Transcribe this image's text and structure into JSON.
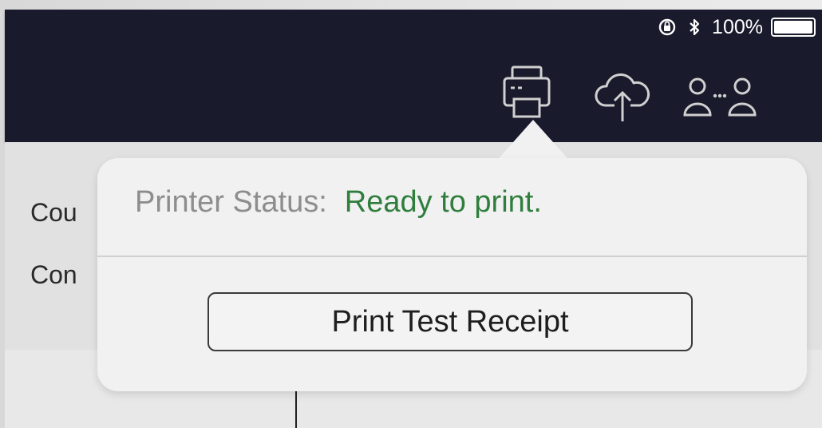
{
  "status_bar": {
    "battery_percent": "100%",
    "icons": [
      "orientation-lock-icon",
      "bluetooth-icon",
      "battery-icon"
    ]
  },
  "toolbar": {
    "icons": [
      "printer-icon",
      "cloud-upload-icon",
      "connected-users-icon"
    ]
  },
  "background": {
    "rows": [
      {
        "label": "Cou"
      },
      {
        "label": "Con"
      }
    ]
  },
  "popover": {
    "status_label": "Printer Status:",
    "status_value": "Ready to print.",
    "status_value_color": "#2f7e3d",
    "button_label": "Print Test Receipt"
  },
  "colors": {
    "topbar": "#191a2c",
    "popover_bg": "#f1f1f1"
  }
}
